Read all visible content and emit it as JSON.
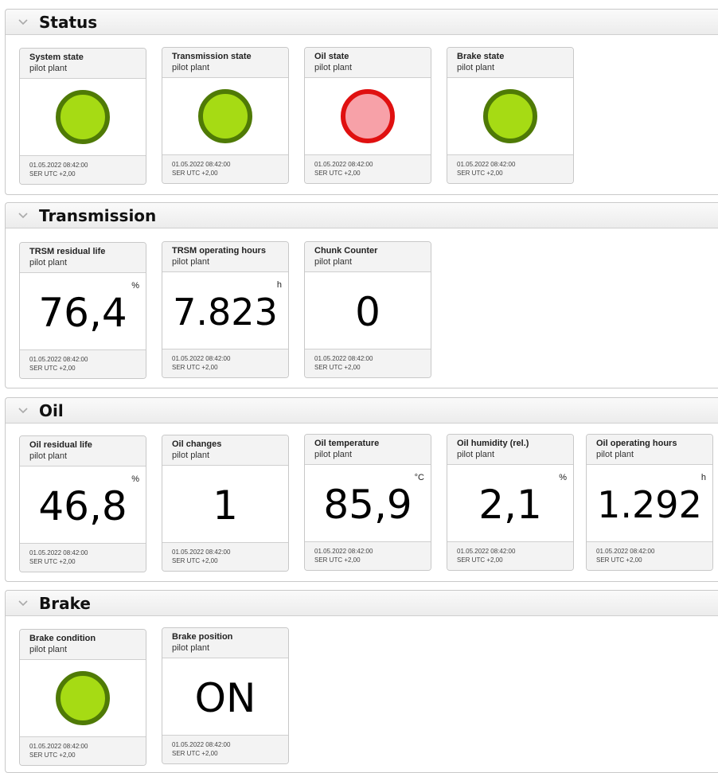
{
  "sections": {
    "status": {
      "title": "Status",
      "tiles": [
        {
          "title": "System state",
          "subtitle": "pilot plant",
          "indicator": "green",
          "timestamp": "01.05.2022 08:42:00",
          "timezone": "SER UTC +2,00"
        },
        {
          "title": "Transmission state",
          "subtitle": "pilot plant",
          "indicator": "green",
          "timestamp": "01.05.2022 08:42:00",
          "timezone": "SER UTC +2,00"
        },
        {
          "title": "Oil state",
          "subtitle": "pilot plant",
          "indicator": "red",
          "timestamp": "01.05.2022 08:42:00",
          "timezone": "SER UTC +2,00"
        },
        {
          "title": "Brake state",
          "subtitle": "pilot plant",
          "indicator": "green",
          "timestamp": "01.05.2022 08:42:00",
          "timezone": "SER UTC +2,00"
        }
      ]
    },
    "transmission": {
      "title": "Transmission",
      "tiles": [
        {
          "title": "TRSM residual life",
          "subtitle": "pilot plant",
          "value": "76,4",
          "unit": "%",
          "timestamp": "01.05.2022 08:42:00",
          "timezone": "SER UTC +2,00"
        },
        {
          "title": "TRSM operating hours",
          "subtitle": "pilot plant",
          "value": "7.823",
          "unit": "h",
          "timestamp": "01.05.2022 08:42:00",
          "timezone": "SER UTC +2,00"
        },
        {
          "title": "Chunk Counter",
          "subtitle": "pilot plant",
          "value": "0",
          "unit": "",
          "timestamp": "01.05.2022 08:42:00",
          "timezone": "SER UTC +2,00"
        }
      ]
    },
    "oil": {
      "title": "Oil",
      "tiles": [
        {
          "title": "Oil residual life",
          "subtitle": "pilot plant",
          "value": "46,8",
          "unit": "%",
          "timestamp": "01.05.2022 08:42:00",
          "timezone": "SER UTC +2,00"
        },
        {
          "title": "Oil changes",
          "subtitle": "pilot plant",
          "value": "1",
          "unit": "",
          "timestamp": "01.05.2022 08:42:00",
          "timezone": "SER UTC +2,00"
        },
        {
          "title": "Oil temperature",
          "subtitle": "pilot plant",
          "value": "85,9",
          "unit": "°C",
          "timestamp": "01.05.2022 08:42:00",
          "timezone": "SER UTC +2,00"
        },
        {
          "title": "Oil humidity (rel.)",
          "subtitle": "pilot plant",
          "value": "2,1",
          "unit": "%",
          "timestamp": "01.05.2022 08:42:00",
          "timezone": "SER UTC +2,00"
        },
        {
          "title": "Oil operating hours",
          "subtitle": "pilot plant",
          "value": "1.292",
          "unit": "h",
          "timestamp": "01.05.2022 08:42:00",
          "timezone": "SER UTC +2,00"
        }
      ]
    },
    "brake": {
      "title": "Brake",
      "tiles": [
        {
          "title": "Brake condition",
          "subtitle": "pilot plant",
          "indicator": "green",
          "timestamp": "01.05.2022 08:42:00",
          "timezone": "SER UTC +2,00"
        },
        {
          "title": "Brake position",
          "subtitle": "pilot plant",
          "value": "ON",
          "unit": "",
          "timestamp": "01.05.2022 08:42:00",
          "timezone": "SER UTC +2,00"
        }
      ]
    }
  },
  "colors": {
    "status_ok_fill": "#a6db14",
    "status_ok_ring": "#4f7a06",
    "status_alert_fill": "#f7a1a8",
    "status_alert_ring": "#e01010"
  }
}
